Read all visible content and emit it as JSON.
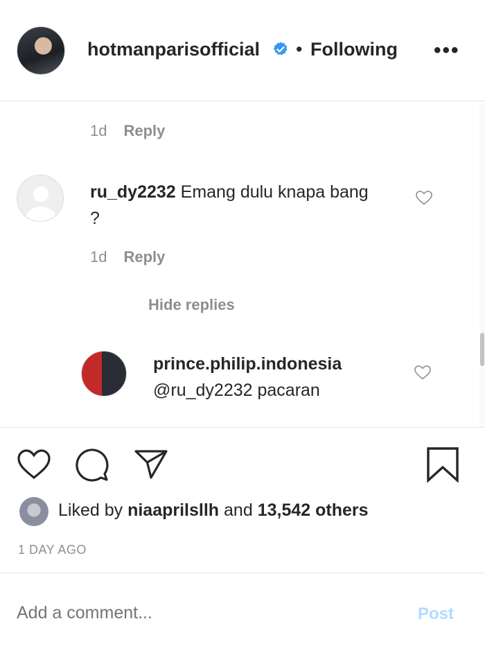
{
  "header": {
    "username": "hotmanparisofficial",
    "separator": "•",
    "follow_status": "Following",
    "more_label": "•••",
    "verified_color": "#3897f0"
  },
  "comments": {
    "prev_meta": {
      "time": "1d",
      "reply": "Reply"
    },
    "comment": {
      "username": "ru_dy2232",
      "text": "Emang dulu knapa bang ?",
      "time": "1d",
      "reply": "Reply"
    },
    "hide_replies": "Hide replies",
    "reply": {
      "username": "prince.philip.indonesia",
      "text": "@ru_dy2232 pacaran"
    }
  },
  "actions": {
    "icons": [
      "heart-icon",
      "comment-icon",
      "share-icon",
      "bookmark-icon"
    ]
  },
  "likes": {
    "prefix": "Liked by",
    "user": "niaaprilsllh",
    "and": "and",
    "count": "13,542 others"
  },
  "post_date": "1 DAY AGO",
  "comment_box": {
    "placeholder": "Add a comment...",
    "post_label": "Post"
  }
}
